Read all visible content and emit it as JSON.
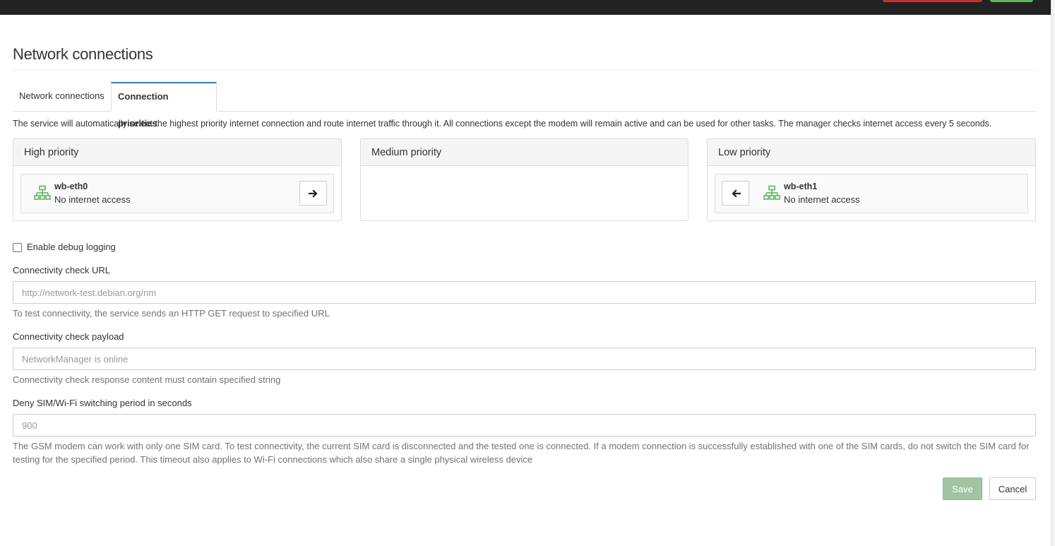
{
  "page": {
    "title": "Network connections"
  },
  "tabs": [
    {
      "label": "Network connections",
      "active": false
    },
    {
      "label": "Connection priorities",
      "active": true
    }
  ],
  "description": "The service will automatically select the highest priority internet connection and route internet traffic through it. All connections except the modem will remain active and can be used for other tasks. The manager checks internet access every 5 seconds.",
  "priorities": {
    "high": {
      "label": "High priority",
      "connections": [
        {
          "name": "wb-eth0",
          "status": "No internet access",
          "icon": "ethernet-network-icon",
          "move_icon": "arrow-right-icon"
        }
      ]
    },
    "medium": {
      "label": "Medium priority",
      "connections": []
    },
    "low": {
      "label": "Low priority",
      "connections": [
        {
          "name": "wb-eth1",
          "status": "No internet access",
          "icon": "ethernet-network-icon",
          "move_icon": "arrow-left-icon"
        }
      ]
    }
  },
  "debug": {
    "label": "Enable debug logging",
    "checked": false
  },
  "fields": {
    "check_url": {
      "label": "Connectivity check URL",
      "placeholder": "http://network-test.debian.org/nm",
      "value": "",
      "help": "To test connectivity, the service sends an HTTP GET request to specified URL"
    },
    "check_payload": {
      "label": "Connectivity check payload",
      "placeholder": "NetworkManager is online",
      "value": "",
      "help": "Connectivity check response content must contain specified string"
    },
    "deny_period": {
      "label": "Deny SIM/Wi-Fi switching period in seconds",
      "placeholder": "900",
      "value": "",
      "help": "The GSM modem can work with only one SIM card. To test connectivity, the current SIM card is disconnected and the tested one is connected. If a modem connection is successfully established with one of the SIM cards, do not switch the SIM card for testing for the specified period. This timeout also applies to Wi-Fi connections which also share a single physical wireless device"
    }
  },
  "actions": {
    "save_label": "Save",
    "cancel_label": "Cancel"
  },
  "colors": {
    "network_icon": "#5cb85c",
    "tab_active_border": "#337ab7",
    "save_disabled": "#a3c4a3"
  }
}
